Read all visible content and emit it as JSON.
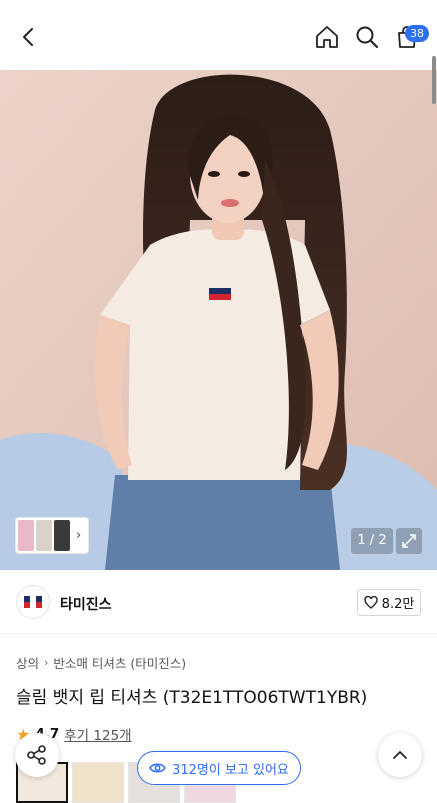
{
  "header": {
    "icons": [
      "back-arrow-icon",
      "home-icon",
      "search-icon",
      "shopping-bag-icon"
    ],
    "cart_count": "38"
  },
  "hero": {
    "page_indicator": "1 / 2"
  },
  "brand": {
    "name": "타미진스",
    "likes": "8.2만"
  },
  "breadcrumb": {
    "items": [
      "상의",
      "반소매 티셔츠 (타미진스)"
    ]
  },
  "product": {
    "title": "슬림 뱃지 립 티셔츠 (T32E1TTO06TWT1YBR)",
    "rating": "4.7",
    "reviews": "후기 125개"
  },
  "floating": {
    "viewers": "312명이 보고 있어요"
  },
  "colors": {
    "accent": "#2b6ff3",
    "star": "#f5a623"
  }
}
